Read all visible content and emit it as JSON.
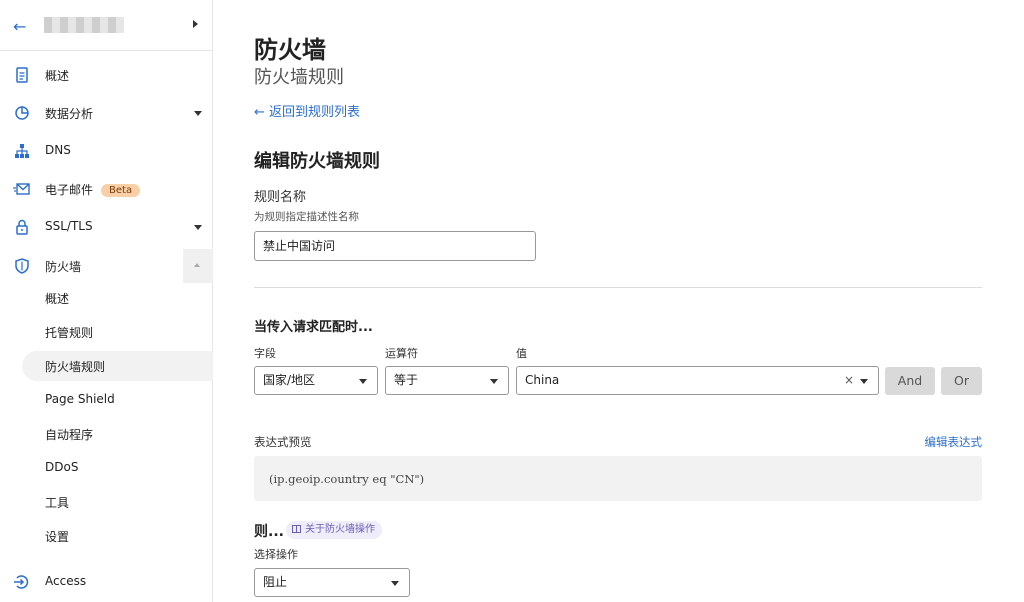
{
  "sidebar": {
    "back_icon": "arrow-left-icon",
    "items": [
      {
        "label": "概述",
        "icon": "document-icon"
      },
      {
        "label": "数据分析",
        "icon": "pie-chart-icon"
      },
      {
        "label": "DNS",
        "icon": "network-icon"
      },
      {
        "label": "电子邮件",
        "icon": "email-icon",
        "badge": "Beta"
      },
      {
        "label": "SSL/TLS",
        "icon": "lock-icon"
      },
      {
        "label": "防火墙",
        "icon": "shield-icon"
      }
    ],
    "firewall_sub": [
      {
        "label": "概述"
      },
      {
        "label": "托管规则"
      },
      {
        "label": "防火墙规则",
        "active": true
      },
      {
        "label": "Page Shield"
      },
      {
        "label": "自动程序"
      },
      {
        "label": "DDoS"
      },
      {
        "label": "工具"
      },
      {
        "label": "设置"
      }
    ],
    "access": {
      "label": "Access",
      "icon": "access-icon"
    }
  },
  "main": {
    "title": "防火墙",
    "subtitle": "防火墙规则",
    "back_link": "← 返回到规则列表",
    "section_title": "编辑防火墙规则",
    "rule_name_label": "规则名称",
    "rule_name_hint": "为规则指定描述性名称",
    "rule_name_value": "禁止中国访问",
    "match_title": "当传入请求匹配时...",
    "field_label": "字段",
    "operator_label": "运算符",
    "value_label": "值",
    "field_value": "国家/地区",
    "operator_value": "等于",
    "value_value": "China",
    "clear_symbol": "×",
    "and_button": "And",
    "or_button": "Or",
    "expr_preview_label": "表达式预览",
    "edit_expr_link": "编辑表达式",
    "expression": "(ip.geoip.country eq \"CN\")",
    "then_label": "则...",
    "about_link": "关于防火墙操作",
    "action_label": "选择操作",
    "action_value": "阻止"
  },
  "colors": {
    "link": "#2c6ecb",
    "badge_bg": "#f8cfa7",
    "button_gray": "#d9d9d9",
    "pill_bg": "#efedf9"
  }
}
